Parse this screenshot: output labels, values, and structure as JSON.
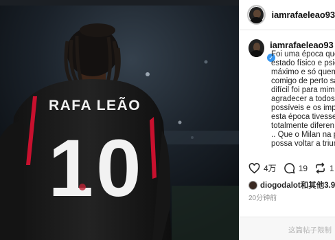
{
  "post": {
    "username": "iamrafaeleao93",
    "jersey_name": "RAFA LEÃO",
    "jersey_number": "10"
  },
  "caption": {
    "lines": [
      "Foi uma época que",
      "estado físico e psic",
      "máximo e só quem",
      "comigo de perto sa",
      "difícil foi para mim",
      "agradecer a todos",
      "possíveis e os impo",
      "esta época tivesse",
      "totalmente diferen",
      ".. Que o Milan na p",
      "possa voltar a triun"
    ]
  },
  "actions": {
    "likes": "4万",
    "comments": "19",
    "reposts": "1"
  },
  "liked_by": {
    "text": "diogodalot和其他3.9"
  },
  "timestamp": "20分钟前",
  "comment_placeholder": "这篇帖子限制"
}
